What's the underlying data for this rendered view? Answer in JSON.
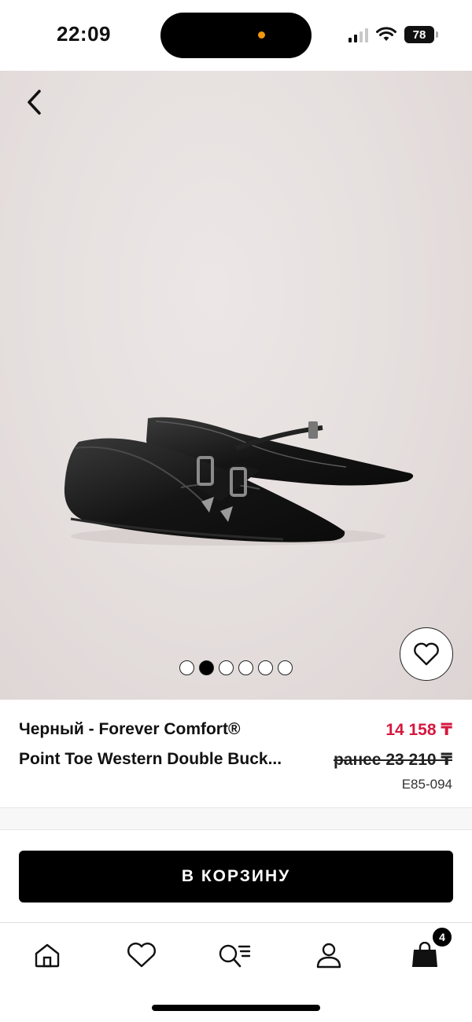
{
  "status_bar": {
    "time": "22:09",
    "battery": "78"
  },
  "product": {
    "title_line_1": "Черный - Forever Comfort®",
    "title_line_2": "Point Toe Western Double Buck...",
    "price_current": "14 158 ₸",
    "price_old": "ранее 23 210 ₸",
    "sku": "E85-094",
    "image_count": 6,
    "active_image": 2
  },
  "actions": {
    "add_to_cart": "В КОРЗИНУ"
  },
  "bottom_nav": {
    "items": [
      "home-icon",
      "heart-icon",
      "search-list-icon",
      "user-icon",
      "shopping-bag-icon"
    ],
    "bag_count": "4"
  },
  "colors": {
    "accent_price": "#d6173f",
    "primary": "#000000",
    "image_bg": "#e6e0df"
  }
}
